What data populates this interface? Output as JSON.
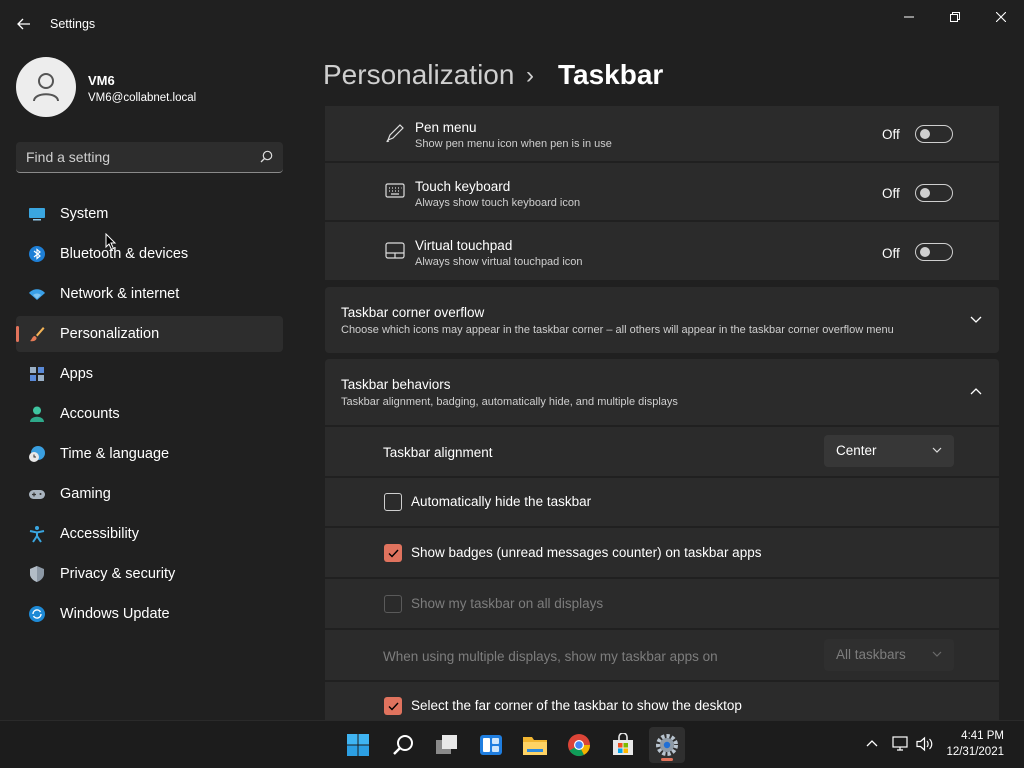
{
  "window": {
    "title": "Settings"
  },
  "profile": {
    "name": "VM6",
    "email": "VM6@collabnet.local"
  },
  "search": {
    "placeholder": "Find a setting"
  },
  "sidebar": {
    "items": [
      {
        "label": "System",
        "icon": "system-icon"
      },
      {
        "label": "Bluetooth & devices",
        "icon": "bluetooth-icon"
      },
      {
        "label": "Network & internet",
        "icon": "wifi-icon"
      },
      {
        "label": "Personalization",
        "icon": "brush-icon",
        "selected": true
      },
      {
        "label": "Apps",
        "icon": "apps-icon"
      },
      {
        "label": "Accounts",
        "icon": "person-icon"
      },
      {
        "label": "Time & language",
        "icon": "clock-globe-icon"
      },
      {
        "label": "Gaming",
        "icon": "gamepad-icon"
      },
      {
        "label": "Accessibility",
        "icon": "accessibility-icon"
      },
      {
        "label": "Privacy & security",
        "icon": "shield-icon"
      },
      {
        "label": "Windows Update",
        "icon": "update-icon"
      }
    ]
  },
  "breadcrumb": {
    "parent": "Personalization",
    "separator": "›",
    "current": "Taskbar"
  },
  "corner_icons": [
    {
      "title": "Pen menu",
      "desc": "Show pen menu icon when pen is in use",
      "state": "Off",
      "icon": "pen-icon"
    },
    {
      "title": "Touch keyboard",
      "desc": "Always show touch keyboard icon",
      "state": "Off",
      "icon": "keyboard-icon"
    },
    {
      "title": "Virtual touchpad",
      "desc": "Always show virtual touchpad icon",
      "state": "Off",
      "icon": "touchpad-icon"
    }
  ],
  "overflow": {
    "title": "Taskbar corner overflow",
    "desc": "Choose which icons may appear in the taskbar corner – all others will appear in the taskbar corner overflow menu"
  },
  "behaviors": {
    "title": "Taskbar behaviors",
    "desc": "Taskbar alignment, badging, automatically hide, and multiple displays",
    "alignment_label": "Taskbar alignment",
    "alignment_value": "Center",
    "auto_hide": {
      "label": "Automatically hide the taskbar",
      "checked": false
    },
    "badges": {
      "label": "Show badges (unread messages counter) on taskbar apps",
      "checked": true
    },
    "all_displays": {
      "label": "Show my taskbar on all displays",
      "checked": false,
      "disabled": true
    },
    "multi_display_label": "When using multiple displays, show my taskbar apps on",
    "multi_display_value": "All taskbars",
    "far_corner": {
      "label": "Select the far corner of the taskbar to show the desktop",
      "checked": true
    }
  },
  "taskbar": {
    "apps": [
      "start-icon",
      "search-icon",
      "task-view-icon",
      "widgets-icon",
      "file-explorer-icon",
      "chrome-icon",
      "store-icon",
      "settings-icon"
    ],
    "time": "4:41 PM",
    "date": "12/31/2021"
  },
  "colors": {
    "accent": "#e2735b",
    "background": "#202020",
    "card": "#2b2b2b"
  }
}
